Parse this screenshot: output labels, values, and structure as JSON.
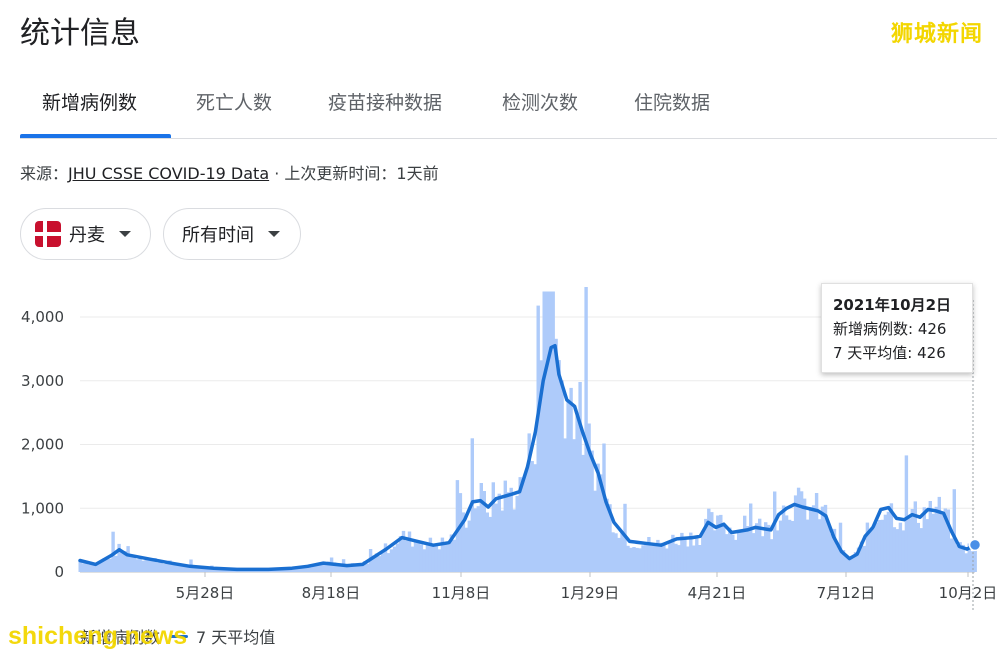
{
  "page_title": "统计信息",
  "watermark_top": "狮城新闻",
  "watermark_bottom": "shicheng.news",
  "tabs": [
    {
      "label": "新增病例数",
      "active": true
    },
    {
      "label": "死亡人数",
      "active": false
    },
    {
      "label": "疫苗接种数据",
      "active": false
    },
    {
      "label": "检测次数",
      "active": false
    },
    {
      "label": "住院数据",
      "active": false
    }
  ],
  "source": {
    "prefix": "来源：",
    "link": "JHU CSSE COVID-19 Data",
    "updated": " · 上次更新时间：1天前"
  },
  "filters": {
    "country": "丹麦",
    "time_range": "所有时间"
  },
  "tooltip": {
    "date": "2021年10月2日",
    "cases_line": "新增病例数: 426",
    "avg_line": "7 天平均值: 426"
  },
  "legend": {
    "bars": "新增病例数",
    "line": "7 天平均值"
  },
  "colors": {
    "accent": "#1a73e8",
    "bar": "#aecbfa",
    "line": "#1a6fd1",
    "watermark": "#f3d600"
  },
  "chart_data": {
    "type": "bar",
    "y_ticks": [
      "0",
      "1,000",
      "2,000",
      "3,000",
      "4,000"
    ],
    "ylim": [
      0,
      4500
    ],
    "x_ticks": [
      {
        "label": "5月28日",
        "t": 0.206
      },
      {
        "label": "8月18日",
        "t": 0.366
      },
      {
        "label": "11月8日",
        "t": 0.526
      },
      {
        "label": "1月29日",
        "t": 0.686
      },
      {
        "label": "4月21日",
        "t": 0.845
      },
      {
        "label": "7月12日",
        "t": 0.998
      },
      {
        "label": "10月2日",
        "t": 1.0
      }
    ],
    "grid": true,
    "series": [
      {
        "name": "7 天平均值",
        "type": "line",
        "points": [
          [
            0.0,
            180
          ],
          [
            0.02,
            120
          ],
          [
            0.04,
            260
          ],
          [
            0.05,
            350
          ],
          [
            0.06,
            270
          ],
          [
            0.09,
            200
          ],
          [
            0.12,
            130
          ],
          [
            0.14,
            90
          ],
          [
            0.17,
            60
          ],
          [
            0.2,
            40
          ],
          [
            0.24,
            40
          ],
          [
            0.27,
            60
          ],
          [
            0.29,
            90
          ],
          [
            0.31,
            140
          ],
          [
            0.34,
            100
          ],
          [
            0.36,
            120
          ],
          [
            0.39,
            360
          ],
          [
            0.41,
            540
          ],
          [
            0.43,
            480
          ],
          [
            0.45,
            420
          ],
          [
            0.47,
            460
          ],
          [
            0.49,
            820
          ],
          [
            0.5,
            1100
          ],
          [
            0.51,
            1120
          ],
          [
            0.52,
            1020
          ],
          [
            0.53,
            1150
          ],
          [
            0.55,
            1220
          ],
          [
            0.56,
            1260
          ],
          [
            0.57,
            1650
          ],
          [
            0.58,
            2200
          ],
          [
            0.59,
            3000
          ],
          [
            0.6,
            3520
          ],
          [
            0.605,
            3550
          ],
          [
            0.61,
            3100
          ],
          [
            0.62,
            2700
          ],
          [
            0.63,
            2600
          ],
          [
            0.64,
            2200
          ],
          [
            0.65,
            1850
          ],
          [
            0.66,
            1550
          ],
          [
            0.67,
            1100
          ],
          [
            0.68,
            780
          ],
          [
            0.7,
            480
          ],
          [
            0.72,
            450
          ],
          [
            0.74,
            420
          ],
          [
            0.76,
            520
          ],
          [
            0.78,
            540
          ],
          [
            0.79,
            560
          ],
          [
            0.8,
            780
          ],
          [
            0.81,
            700
          ],
          [
            0.82,
            750
          ],
          [
            0.83,
            620
          ],
          [
            0.85,
            660
          ],
          [
            0.86,
            700
          ],
          [
            0.88,
            660
          ],
          [
            0.89,
            900
          ],
          [
            0.9,
            1000
          ],
          [
            0.91,
            1060
          ],
          [
            0.92,
            1020
          ],
          [
            0.94,
            960
          ],
          [
            0.95,
            880
          ],
          [
            0.96,
            550
          ],
          [
            0.97,
            320
          ],
          [
            0.98,
            210
          ],
          [
            0.99,
            280
          ],
          [
            1.0,
            560
          ],
          [
            1.01,
            700
          ],
          [
            1.02,
            980
          ],
          [
            1.03,
            1010
          ],
          [
            1.04,
            840
          ],
          [
            1.05,
            820
          ],
          [
            1.06,
            900
          ],
          [
            1.07,
            860
          ],
          [
            1.08,
            980
          ],
          [
            1.09,
            960
          ],
          [
            1.1,
            920
          ],
          [
            1.11,
            640
          ],
          [
            1.12,
            400
          ],
          [
            1.13,
            360
          ],
          [
            1.14,
            426
          ]
        ]
      },
      {
        "name": "新增病例数",
        "type": "bar"
      }
    ],
    "end_point": {
      "x": 1.14,
      "y": 426
    }
  }
}
